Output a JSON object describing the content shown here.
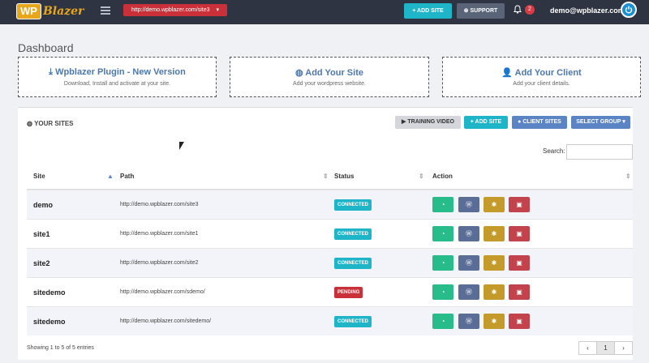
{
  "topbar": {
    "logo_wp": "WP",
    "logo_rest": "Blazer",
    "url_select": "http://demo.wpblazer.com/site3",
    "add_site": "ADD SITE",
    "support": "SUPPORT",
    "notif_count": "2",
    "user_email": "demo@wpblazer.com"
  },
  "dashboard": {
    "title": "Dashboard",
    "cards": [
      {
        "icon": "download-icon",
        "title": "Wpblazer Plugin - New Version",
        "subtitle": "Download, Install and activate at your site."
      },
      {
        "icon": "globe-icon",
        "title": "Add Your Site",
        "subtitle": "Add your wordpress website."
      },
      {
        "icon": "user-icon",
        "title": "Add Your Client",
        "subtitle": "Add your client details."
      }
    ]
  },
  "sites_panel": {
    "title": "YOUR SITES",
    "training_video": "TRAINING VIDEO",
    "add_site": "ADD SITE",
    "client_sites": "CLIENT SITES",
    "select_group": "SELECT GROUP",
    "search_label": "Search:",
    "search_value": "",
    "columns": [
      "Site",
      "Path",
      "Status",
      "Action"
    ],
    "rows": [
      {
        "site": "demo",
        "path": "http://demo.wpblazer.com/site3",
        "status": "CONNECTED"
      },
      {
        "site": "site1",
        "path": "http://demo.wpblazer.com/site1",
        "status": "CONNECTED"
      },
      {
        "site": "site2",
        "path": "http://demo.wpblazer.com/site2",
        "status": "CONNECTED"
      },
      {
        "site": "sitedemo",
        "path": "http://demo.wpblazer.com/sdemo/",
        "status": "PENDING"
      },
      {
        "site": "sitedemo",
        "path": "http://demo.wpblazer.com/sitedemo/",
        "status": "CONNECTED"
      }
    ],
    "footer": "Showing 1 to 5 of 5 entries",
    "pager": [
      "‹",
      "1",
      "›"
    ]
  },
  "colors": {
    "topbar": "#2f3442",
    "connected": "#1eb5c8",
    "pending": "#c9303a",
    "dashboard_btn": "#27bc8a",
    "wordpress_btn": "#5a6d96",
    "settings_btn": "#c49a2b",
    "delete_btn": "#c2434b"
  }
}
